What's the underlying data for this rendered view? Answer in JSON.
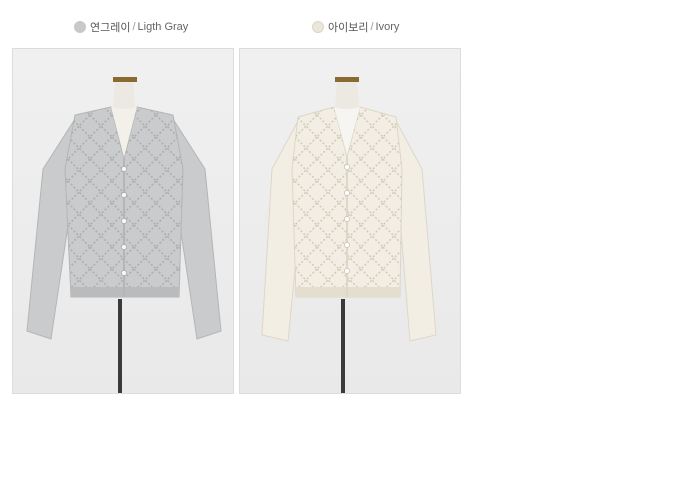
{
  "colors": [
    {
      "korean": "연그레이",
      "separator": "/",
      "english": "Ligth Gray",
      "swatch_color": "#c8c8c8",
      "garment_color": "#c9cbcc",
      "garment_shade": "#b3b5b7",
      "image_icon": "cardigan-on-mannequin-gray"
    },
    {
      "korean": "아이보리",
      "separator": "/",
      "english": "Ivory",
      "swatch_color": "#ebe6da",
      "garment_color": "#f2eee3",
      "garment_shade": "#ddd7c7",
      "image_icon": "cardigan-on-mannequin-ivory"
    }
  ]
}
